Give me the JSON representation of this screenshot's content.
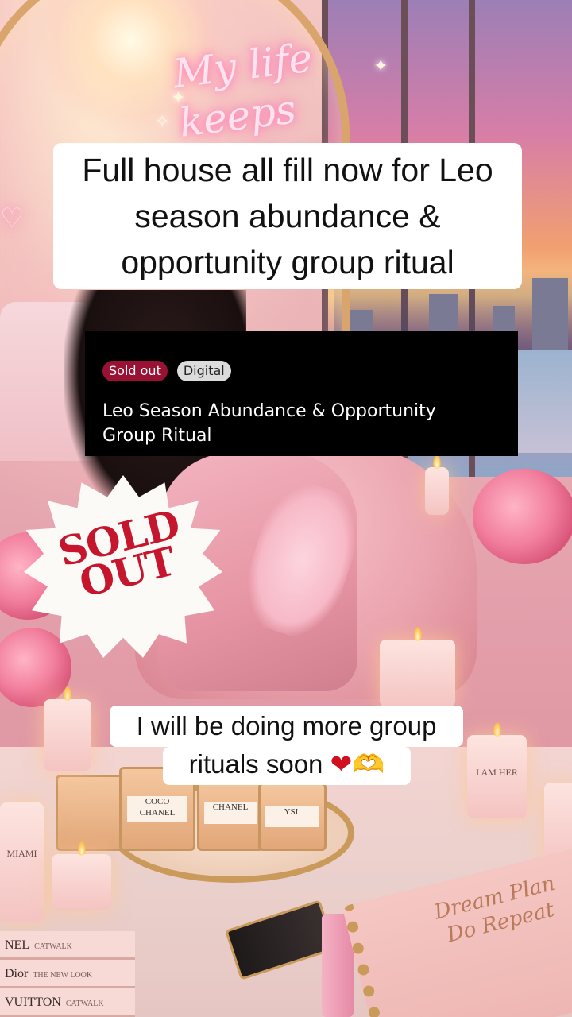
{
  "background": {
    "neon_sign": "My life keeps getting",
    "bottle_labels": [
      "COCO",
      "CHANEL",
      "CHANEL",
      "YSL"
    ],
    "candle_labels": [
      "MIAMI",
      "I AM HER"
    ],
    "book_titles": [
      {
        "title": "NEL",
        "sub": "CATWALK"
      },
      {
        "title": "Dior",
        "sub": "THE NEW LOOK"
      },
      {
        "title": "VUITTON",
        "sub": "CATWALK"
      }
    ],
    "notebook_text": "Dream Plan Do Repeat",
    "accent_colors": {
      "sold_out_badge": "#9a1233",
      "burst_text": "#c5162e"
    }
  },
  "top_caption": {
    "text": "Full house all fill  now for Leo season abundance & opportunity group ritual"
  },
  "product_card": {
    "badge_sold_out": "Sold out",
    "badge_digital": "Digital",
    "title": "Leo Season Abundance & Opportunity Group Ritual"
  },
  "sold_out_sticker": {
    "line1": "SOLD",
    "line2": "OUT"
  },
  "bottom_caption": {
    "line1": "I will be doing more group",
    "line2_text": "rituals  soon",
    "line2_emoji_1": "❤",
    "line2_emoji_2": "🫶"
  }
}
